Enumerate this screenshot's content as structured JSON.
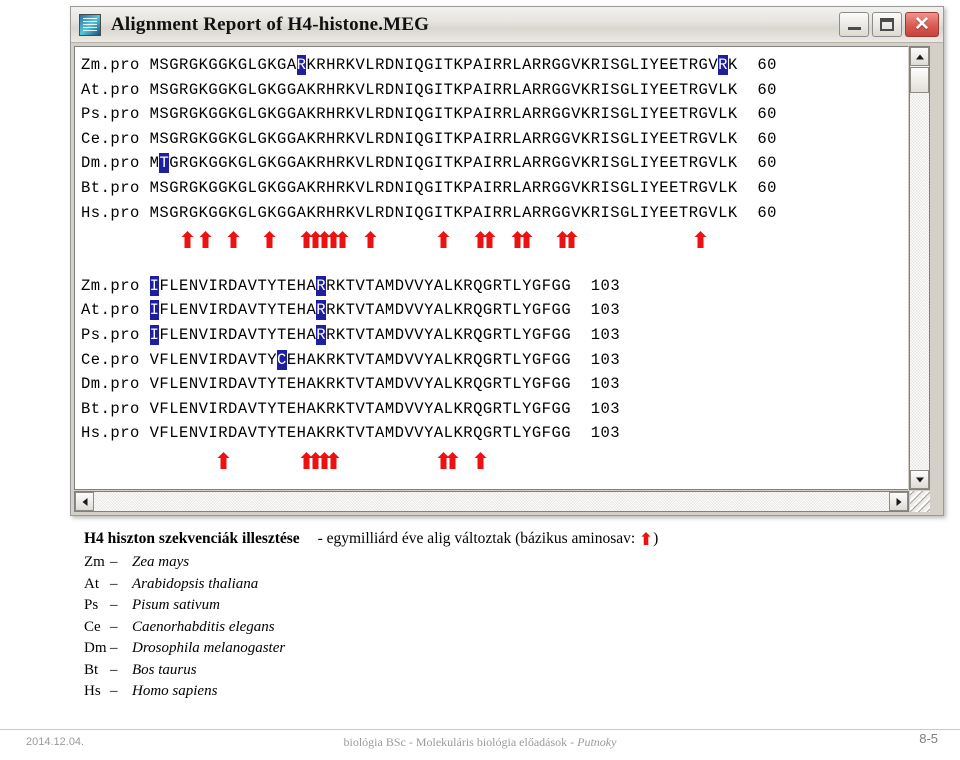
{
  "window": {
    "title": "Alignment Report of H4-histone.MEG",
    "app_icon": "alignment-app-icon",
    "minimize_label": "",
    "maximize_label": "",
    "close_label": "✕"
  },
  "alignment": {
    "block1": {
      "rows": [
        {
          "label": "Zm.pro",
          "seq": "MSGRGKGGKGLGKGARKRHRKVLRDNIQGITKPAIRRLARRGGVKRISGLIYEETRGVRK",
          "number": "60",
          "highlights": [
            15,
            58
          ]
        },
        {
          "label": "At.pro",
          "seq": "MSGRGKGGKGLGKGGAKRHRKVLRDNIQGITKPAIRRLARRGGVKRISGLIYEETRGVLK",
          "number": "60",
          "highlights": []
        },
        {
          "label": "Ps.pro",
          "seq": "MSGRGKGGKGLGKGGAKRHRKVLRDNIQGITKPAIRRLARRGGVKRISGLIYEETRGVLK",
          "number": "60",
          "highlights": []
        },
        {
          "label": "Ce.pro",
          "seq": "MSGRGKGGKGLGKGGAKRHRKVLRDNIQGITKPAIRRLARRGGVKRISGLIYEETRGVLK",
          "number": "60",
          "highlights": []
        },
        {
          "label": "Dm.pro",
          "seq": "MTGRGKGGKGLGKGGAKRHRKVLRDNIQGITKPAIRRLARRGGVKRISGLIYEETRGVLK",
          "number": "60",
          "highlights": [
            1
          ]
        },
        {
          "label": "Bt.pro",
          "seq": "MSGRGKGGKGLGKGGAKRHRKVLRDNIQGITKPAIRRLARRGGVKRISGLIYEETRGVLK",
          "number": "60",
          "highlights": []
        },
        {
          "label": "Hs.pro",
          "seq": "MSGRGKGGKGLGKGGAKRHRKVLRDNIQGITKPAIRRLARRGGVKRISGLIYEETRGVLK",
          "number": "60",
          "highlights": []
        }
      ],
      "basic_marker_positions": [
        3,
        5,
        8,
        12,
        16,
        17,
        18,
        19,
        20,
        23,
        31,
        35,
        36,
        39,
        40,
        44,
        45,
        59
      ]
    },
    "block2": {
      "rows": [
        {
          "label": "Zm.pro",
          "seq": "IFLENVIRDAVTYTEHARRKTVTAMDVVYALKRQGRTLYGFGG",
          "number": "103",
          "highlights": [
            0,
            17
          ]
        },
        {
          "label": "At.pro",
          "seq": "IFLENVIRDAVTYTEHARRKTVTAMDVVYALKRQGRTLYGFGG",
          "number": "103",
          "highlights": [
            0,
            17
          ]
        },
        {
          "label": "Ps.pro",
          "seq": "IFLENVIRDAVTYTEHARRKTVTAMDVVYALKRQGRTLYGFGG",
          "number": "103",
          "highlights": [
            0,
            17
          ]
        },
        {
          "label": "Ce.pro",
          "seq": "VFLENVIRDAVTYCEHAKRKTVTAMDVVYALKRQGRTLYGFGG",
          "number": "103",
          "highlights": [
            13
          ]
        },
        {
          "label": "Dm.pro",
          "seq": "VFLENVIRDAVTYTEHAKRKTVTAMDVVYALKRQGRTLYGFGG",
          "number": "103",
          "highlights": []
        },
        {
          "label": "Bt.pro",
          "seq": "VFLENVIRDAVTYTEHAKRKTVTAMDVVYALKRQGRTLYGFGG",
          "number": "103",
          "highlights": []
        },
        {
          "label": "Hs.pro",
          "seq": "VFLENVIRDAVTYTEHAKRKTVTAMDVVYALKRQGRTLYGFGG",
          "number": "103",
          "highlights": []
        }
      ],
      "basic_marker_positions": [
        7,
        16,
        17,
        18,
        19,
        31,
        32,
        35
      ]
    },
    "decoration_note": "Decoration 'Decoration #1': Shade (with solid bright cobalt)",
    "highlight_color": "#1e1ea0",
    "marker_color": "#ee1111"
  },
  "caption": {
    "title": "H4 hiszton szekvenciák illesztése",
    "subtitle_pre": "- egymilliárd éve alig változtak  (bázikus aminosav: ",
    "subtitle_post": ")",
    "species": [
      {
        "code": "Zm",
        "dash": "–",
        "name": "Zea mays"
      },
      {
        "code": "At",
        "dash": "–",
        "name": "Arabidopsis thaliana"
      },
      {
        "code": "Ps",
        "dash": "–",
        "name": "Pisum sativum"
      },
      {
        "code": "Ce",
        "dash": "–",
        "name": "Caenorhabditis elegans"
      },
      {
        "code": "Dm",
        "dash": "–",
        "name": "Drosophila melanogaster"
      },
      {
        "code": "Bt",
        "dash": "–",
        "name": "Bos taurus"
      },
      {
        "code": "Hs",
        "dash": "–",
        "name": "Homo sapiens"
      }
    ]
  },
  "footer": {
    "date": "2014.12.04.",
    "course_prefix": "biológia BSc - Molekuláris biológia előadások  -  ",
    "author": "Putnoky",
    "page": "8-5"
  }
}
